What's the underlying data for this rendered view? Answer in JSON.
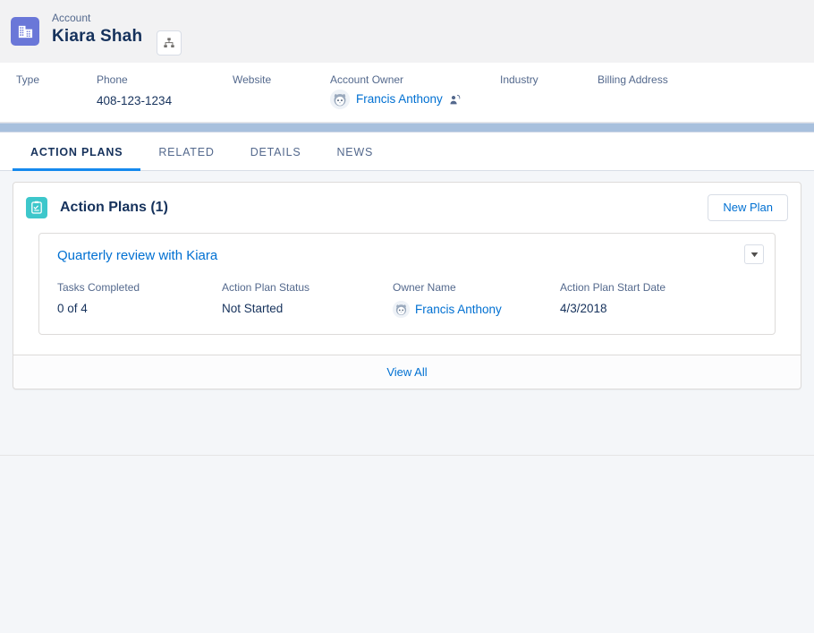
{
  "header": {
    "object_label": "Account",
    "record_name": "Kiara Shah",
    "object_icon": "account-building-icon",
    "hierarchy_button_icon": "hierarchy-icon"
  },
  "highlights": {
    "fields": [
      {
        "label": "Type",
        "value": ""
      },
      {
        "label": "Phone",
        "value": "408-123-1234"
      },
      {
        "label": "Website",
        "value": ""
      },
      {
        "label": "Account Owner",
        "value": "Francis Anthony",
        "is_link": true,
        "avatar": "user-avatar",
        "action_icon": "change-owner-icon"
      },
      {
        "label": "Industry",
        "value": ""
      },
      {
        "label": "Billing Address",
        "value": ""
      }
    ]
  },
  "tabs": [
    {
      "label": "ACTION PLANS",
      "active": true
    },
    {
      "label": "RELATED",
      "active": false
    },
    {
      "label": "DETAILS",
      "active": false
    },
    {
      "label": "NEWS",
      "active": false
    }
  ],
  "card": {
    "icon": "action-plan-clipboard-icon",
    "title": "Action Plans (1)",
    "new_plan_label": "New Plan",
    "menu_icon": "chevron-down-icon",
    "view_all_label": "View All",
    "plan": {
      "title": "Quarterly review with Kiara",
      "fields": [
        {
          "label": "Tasks Completed",
          "value": "0 of 4"
        },
        {
          "label": "Action Plan Status",
          "value": "Not Started"
        },
        {
          "label": "Owner Name",
          "value": "Francis Anthony",
          "is_link": true,
          "avatar": "user-avatar"
        },
        {
          "label": "Action Plan Start Date",
          "value": "4/3/2018"
        }
      ]
    }
  },
  "colors": {
    "object_icon_bg": "#6a77d8",
    "card_icon_bg": "#3dc7cb",
    "link": "#0070d2",
    "active_tab_underline": "#1589ee",
    "separator_band": "#a8c0dd"
  }
}
